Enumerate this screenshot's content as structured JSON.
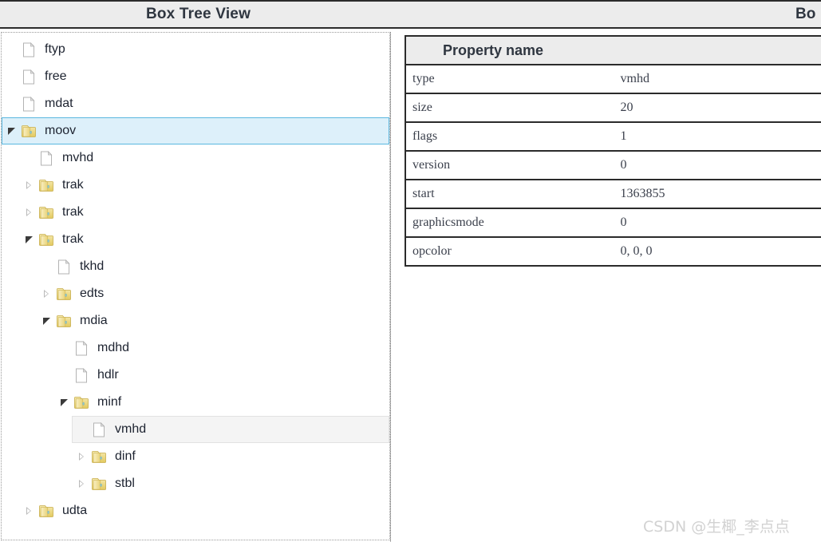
{
  "header": {
    "left_title": "Box Tree View",
    "right_title": "Bo"
  },
  "tree": {
    "nodes": [
      {
        "label": "ftyp",
        "icon": "file-icon",
        "depth": 0,
        "arrow": "none",
        "state": "normal"
      },
      {
        "label": "free",
        "icon": "file-icon",
        "depth": 0,
        "arrow": "none",
        "state": "normal"
      },
      {
        "label": "mdat",
        "icon": "file-icon",
        "depth": 0,
        "arrow": "none",
        "state": "normal"
      },
      {
        "label": "moov",
        "icon": "folder-icon",
        "depth": 0,
        "arrow": "expanded",
        "state": "selected"
      },
      {
        "label": "mvhd",
        "icon": "file-icon",
        "depth": 1,
        "arrow": "none",
        "state": "normal"
      },
      {
        "label": "trak",
        "icon": "folder-icon",
        "depth": 1,
        "arrow": "collapsed",
        "state": "normal"
      },
      {
        "label": "trak",
        "icon": "folder-icon",
        "depth": 1,
        "arrow": "collapsed",
        "state": "normal"
      },
      {
        "label": "trak",
        "icon": "folder-icon",
        "depth": 1,
        "arrow": "expanded",
        "state": "normal"
      },
      {
        "label": "tkhd",
        "icon": "file-icon",
        "depth": 2,
        "arrow": "none",
        "state": "normal"
      },
      {
        "label": "edts",
        "icon": "folder-icon",
        "depth": 2,
        "arrow": "collapsed",
        "state": "normal"
      },
      {
        "label": "mdia",
        "icon": "folder-icon",
        "depth": 2,
        "arrow": "expanded",
        "state": "normal"
      },
      {
        "label": "mdhd",
        "icon": "file-icon",
        "depth": 3,
        "arrow": "none",
        "state": "normal"
      },
      {
        "label": "hdlr",
        "icon": "file-icon",
        "depth": 3,
        "arrow": "none",
        "state": "normal"
      },
      {
        "label": "minf",
        "icon": "folder-icon",
        "depth": 3,
        "arrow": "expanded",
        "state": "normal"
      },
      {
        "label": "vmhd",
        "icon": "file-icon",
        "depth": 4,
        "arrow": "none",
        "state": "hovered"
      },
      {
        "label": "dinf",
        "icon": "folder-icon",
        "depth": 4,
        "arrow": "collapsed",
        "state": "normal"
      },
      {
        "label": "stbl",
        "icon": "folder-icon",
        "depth": 4,
        "arrow": "collapsed",
        "state": "normal"
      },
      {
        "label": "udta",
        "icon": "folder-icon",
        "depth": 1,
        "arrow": "collapsed",
        "state": "normal"
      }
    ]
  },
  "properties": {
    "header": "Property name",
    "rows": [
      {
        "name": "type",
        "value": "vmhd"
      },
      {
        "name": "size",
        "value": "20"
      },
      {
        "name": "flags",
        "value": "1"
      },
      {
        "name": "version",
        "value": "0"
      },
      {
        "name": "start",
        "value": "1363855"
      },
      {
        "name": "graphicsmode",
        "value": "0"
      },
      {
        "name": "opcolor",
        "value": "0, 0, 0"
      }
    ]
  },
  "watermark": {
    "text": "CSDN @生椰_李点点"
  },
  "colors": {
    "header_bg": "#ececec",
    "header_border": "#2b2b2b",
    "selection_bg": "#ddf0fa",
    "selection_border": "#5ab7e0",
    "hover_bg": "#f4f4f4",
    "folder": "#ead98a",
    "watermark": "#d2d2d2"
  }
}
